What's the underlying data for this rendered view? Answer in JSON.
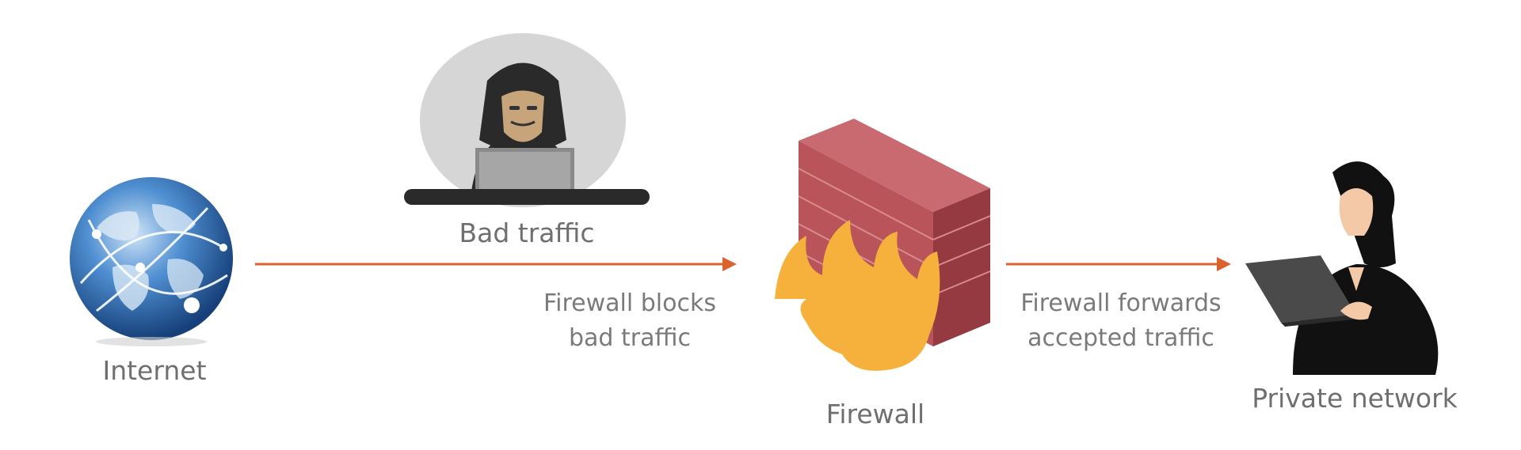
{
  "nodes": {
    "internet": {
      "label": "Internet",
      "icon": "globe-icon"
    },
    "bad_traffic": {
      "label": "Bad traffic",
      "icon": "hacker-icon"
    },
    "firewall": {
      "label": "Firewall",
      "icon": "firewall-icon"
    },
    "private_network": {
      "label": "Private network",
      "icon": "user-laptop-icon"
    }
  },
  "edges": {
    "block": {
      "label_line1": "Firewall blocks",
      "label_line2": "bad traffic"
    },
    "forward": {
      "label_line1": "Firewall forwards",
      "label_line2": "accepted traffic"
    }
  },
  "colors": {
    "arrow": "#d9622e",
    "text": "#6f6f6f",
    "brick": "#a8474d",
    "flame": "#f6b13d",
    "globe": "#2f6fb5"
  }
}
